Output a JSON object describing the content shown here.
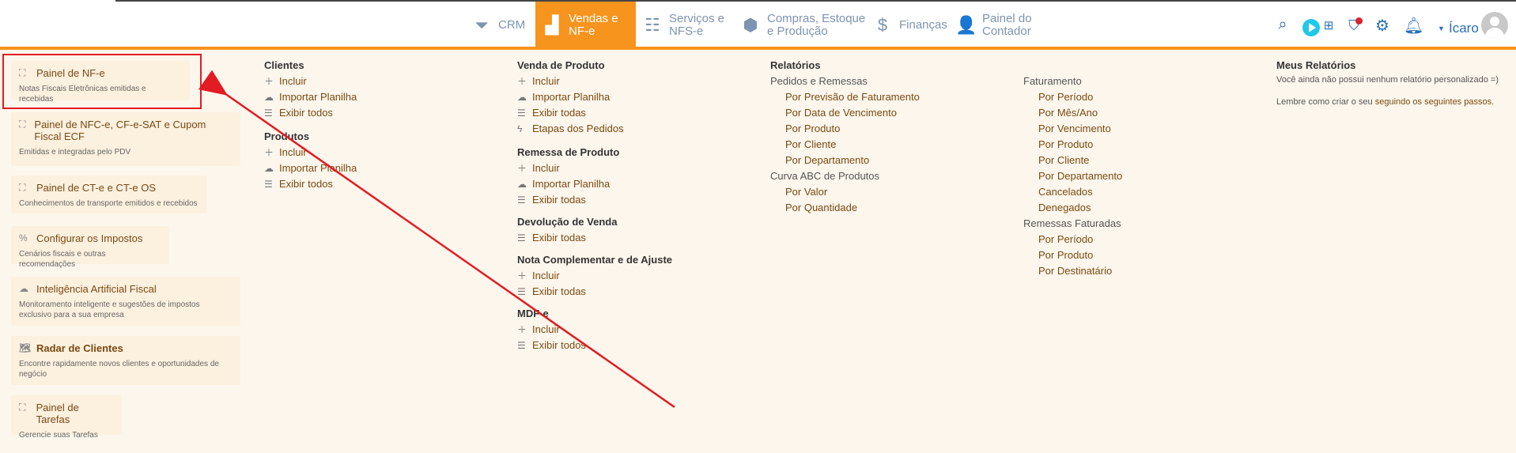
{
  "nav": {
    "items": [
      {
        "label": "CRM",
        "icon": "filter-icon",
        "active": false
      },
      {
        "label": "Vendas e\nNF-e",
        "icon": "chart-icon",
        "active": true
      },
      {
        "label": "Serviços e\nNFS-e",
        "icon": "checklist-icon",
        "active": false
      },
      {
        "label": "Compras, Estoque\ne Produção",
        "icon": "box-icon",
        "active": false
      },
      {
        "label": "Finanças",
        "icon": "dollar-icon",
        "active": false
      },
      {
        "label": "Painel do\nContador",
        "icon": "person-icon",
        "active": false
      }
    ],
    "user_name": "Ícaro",
    "accent": "#f7941d"
  },
  "cards": [
    {
      "title": "Painel de NF-e",
      "subtitle": "Notas Fiscais Eletrônicas emitidas e recebidas",
      "icon": "expand-icon"
    },
    {
      "title": "Painel de NFC-e, CF-e-SAT e Cupom Fiscal ECF",
      "subtitle": "Emitidas e integradas pelo PDV",
      "icon": "expand-icon"
    },
    {
      "title": "Painel de CT-e e CT-e OS",
      "subtitle": "Conhecimentos de transporte emitidos e recebidos",
      "icon": "expand-icon"
    },
    {
      "title": "Configurar os Impostos",
      "subtitle": "Cenários fiscais e outras recomendações",
      "icon": "percent-icon"
    },
    {
      "title": "Inteligência Artificial Fiscal",
      "subtitle": "Monitoramento inteligente e sugestões de impostos exclusivo para a sua empresa",
      "icon": "ai-icon"
    },
    {
      "title": "Radar de Clientes",
      "subtitle": "Encontre rapidamente novos clientes e oportunidades de negócio",
      "icon": "map-icon"
    },
    {
      "title": "Painel de Tarefas",
      "subtitle": "Gerencie suas Tarefas",
      "icon": "expand-icon"
    }
  ],
  "col1": {
    "clientes": {
      "title": "Clientes",
      "items": [
        "Incluir",
        "Importar Planilha",
        "Exibir todos"
      ]
    },
    "produtos": {
      "title": "Produtos",
      "items": [
        "Incluir",
        "Importar Planilha",
        "Exibir todos"
      ]
    }
  },
  "col2": {
    "venda": {
      "title": "Venda de Produto",
      "items": [
        "Incluir",
        "Importar Planilha",
        "Exibir todas",
        "Etapas dos Pedidos"
      ]
    },
    "remessa": {
      "title": "Remessa de Produto",
      "items": [
        "Incluir",
        "Importar Planilha",
        "Exibir todas"
      ]
    },
    "devolucao": {
      "title": "Devolução de Venda",
      "items": [
        "Exibir todas"
      ]
    },
    "nota": {
      "title": "Nota Complementar e de Ajuste",
      "items": [
        "Incluir",
        "Exibir todas"
      ]
    },
    "mdfe": {
      "title": "MDF-e",
      "items": [
        "Incluir",
        "Exibir todos"
      ]
    }
  },
  "col3": {
    "title": "Relatórios",
    "group1": "Pedidos e Remessas",
    "group1_items": [
      "Por Previsão de Faturamento",
      "Por Data de Vencimento",
      "Por Produto",
      "Por Cliente",
      "Por Departamento"
    ],
    "group2": "Curva ABC de Produtos",
    "group2_items": [
      "Por Valor",
      "Por Quantidade"
    ]
  },
  "col4": {
    "group1": "Faturamento",
    "group1_items": [
      "Por Período",
      "Por Mês/Ano",
      "Por Vencimento",
      "Por Produto",
      "Por Cliente",
      "Por Departamento",
      "Cancelados",
      "Denegados"
    ],
    "group2": "Remessas Faturadas",
    "group2_items": [
      "Por Período",
      "Por Produto",
      "Por Destinatário"
    ]
  },
  "col5": {
    "title": "Meus Relatórios",
    "note1": "Você ainda não possui nenhum relatório personalizado =)",
    "note2_prefix": "Lembre como criar o seu ",
    "note2_link": "seguindo os seguintes passos."
  }
}
